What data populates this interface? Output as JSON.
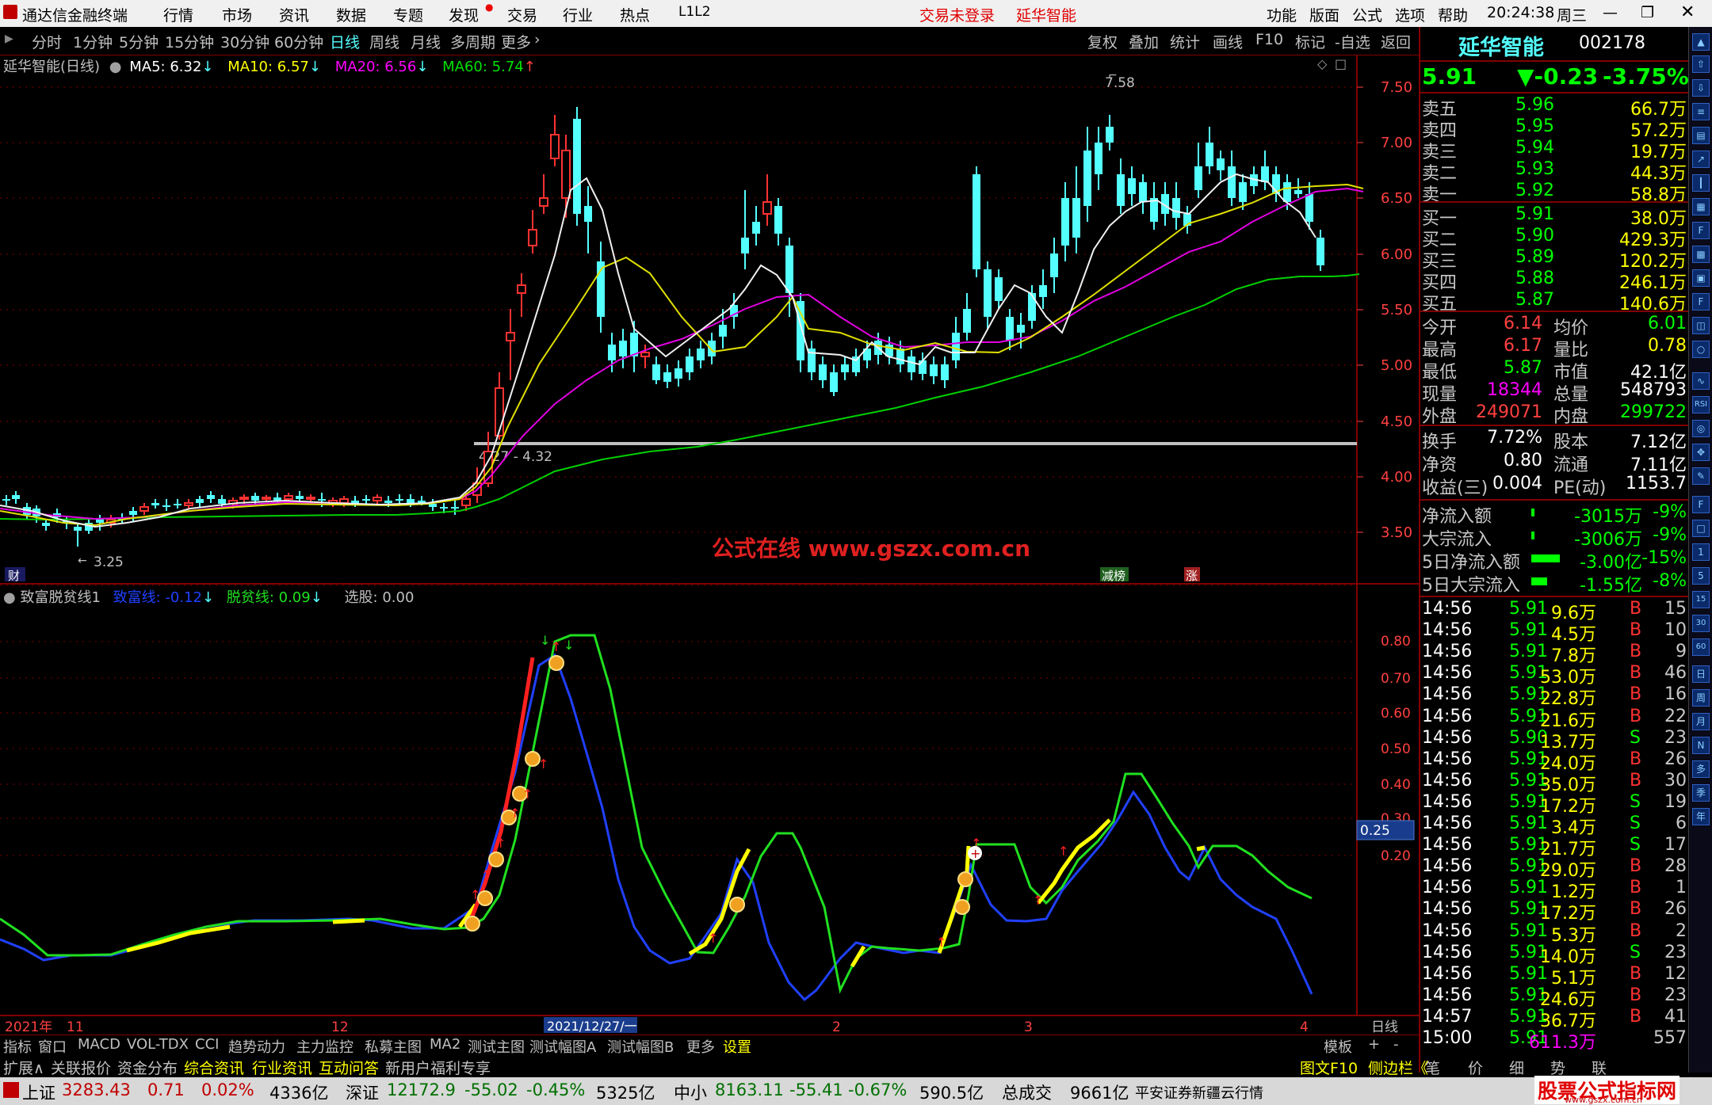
{
  "titlebar": {
    "app_name": "通达信金融终端",
    "menus": [
      "行情",
      "市场",
      "资讯",
      "数据",
      "专题",
      "发现",
      "交易",
      "行业",
      "热点",
      "L1L2"
    ],
    "login_status": "交易未登录",
    "stock_title": "延华智能",
    "right_menus": [
      "功能",
      "版面",
      "公式",
      "选项",
      "帮助"
    ],
    "time": "20:24:38",
    "weekday": "周三"
  },
  "periodbar": {
    "periods": [
      "分时",
      "1分钟",
      "5分钟",
      "15分钟",
      "30分钟",
      "60分钟",
      "日线",
      "周线",
      "月线",
      "多周期",
      "更多"
    ],
    "active": "日线",
    "tools": [
      "复权",
      "叠加",
      "统计",
      "画线",
      "F10",
      "标记",
      "-自选",
      "返回"
    ]
  },
  "main_chart": {
    "title": "延华智能(日线)",
    "ma_labels": [
      {
        "text": "MA5: 6.32",
        "arrow": "↓",
        "color": "#ffffff"
      },
      {
        "text": "MA10: 6.57",
        "arrow": "↓",
        "color": "#ffff00"
      },
      {
        "text": "MA20: 6.56",
        "arrow": "↓",
        "color": "#ff00ff"
      },
      {
        "text": "MA60: 5.74",
        "arrow": "↑",
        "color": "#00e000"
      }
    ],
    "y_ticks": [
      "7.50",
      "7.00",
      "6.50",
      "6.00",
      "5.50",
      "5.00",
      "4.50",
      "4.00",
      "3.50"
    ],
    "high_label": "7.58",
    "low_label": "3.25",
    "line_label": "4/27 - 4.32",
    "watermark": "公式在线   www.gszx.com.cn",
    "marker_cai": "财",
    "marker_rank": "减榜",
    "marker_zhang": "涨"
  },
  "indicator": {
    "name": "致富脱贫线1",
    "line1_label": "致富线: -0.12",
    "line1_arrow": "↓",
    "line2_label": "脱贫线: 0.09",
    "line2_arrow": "↓",
    "select_label": "选股: 0.00",
    "y_ticks": [
      "0.80",
      "0.70",
      "0.60",
      "0.50",
      "0.40",
      "0.30",
      "0.20"
    ],
    "current_value": "0.25"
  },
  "x_axis": {
    "labels": [
      "2021年",
      "11",
      "12",
      "2021/12/27/一",
      "2",
      "3",
      "4"
    ],
    "period_label": "日线"
  },
  "bottom_tabs": [
    "指标",
    "窗口",
    "MACD",
    "VOL-TDX",
    "CCI",
    "趋势动力",
    "主力监控",
    "私募主图",
    "MA2",
    "测试主图",
    "测试幅图A",
    "测试幅图B",
    "更多",
    "设置"
  ],
  "bottom_tabs_right": [
    "模板",
    "+",
    "-"
  ],
  "bottom_tabs2": [
    "扩展∧",
    "关联报价",
    "资金分布",
    "综合资讯",
    "行业资讯",
    "互动问答",
    "新用户福利专享"
  ],
  "bottom_tabs2_right": [
    "图文F10",
    "侧边栏《",
    "笔",
    "价",
    "细",
    "势",
    "联"
  ],
  "quote": {
    "name": "延华智能",
    "code": "002178",
    "price": "5.91",
    "change": "▼-0.23",
    "change_pct": "-3.75%",
    "asks": [
      {
        "label": "卖五",
        "price": "5.96",
        "vol": "66.7万"
      },
      {
        "label": "卖四",
        "price": "5.95",
        "vol": "57.2万"
      },
      {
        "label": "卖三",
        "price": "5.94",
        "vol": "19.7万"
      },
      {
        "label": "卖二",
        "price": "5.93",
        "vol": "44.3万"
      },
      {
        "label": "卖一",
        "price": "5.92",
        "vol": "58.8万"
      }
    ],
    "bids": [
      {
        "label": "买一",
        "price": "5.91",
        "vol": "38.0万"
      },
      {
        "label": "买二",
        "price": "5.90",
        "vol": "429.3万"
      },
      {
        "label": "买三",
        "price": "5.89",
        "vol": "120.2万"
      },
      {
        "label": "买四",
        "price": "5.88",
        "vol": "246.1万"
      },
      {
        "label": "买五",
        "price": "5.87",
        "vol": "140.6万"
      }
    ],
    "stats": [
      {
        "l1": "今开",
        "v1": "6.14",
        "l2": "均价",
        "v2": "6.01"
      },
      {
        "l1": "最高",
        "v1": "6.17",
        "l2": "量比",
        "v2": "0.78"
      },
      {
        "l1": "最低",
        "v1": "5.87",
        "l2": "市值",
        "v2": "42.1亿"
      },
      {
        "l1": "现量",
        "v1": "18344",
        "l2": "总量",
        "v2": "548793"
      },
      {
        "l1": "外盘",
        "v1": "249071",
        "l2": "内盘",
        "v2": "299722"
      }
    ],
    "stats2": [
      {
        "l1": "换手",
        "v1": "7.72%",
        "l2": "股本",
        "v2": "7.12亿"
      },
      {
        "l1": "净资",
        "v1": "0.80",
        "l2": "流通",
        "v2": "7.11亿"
      },
      {
        "l1": "收益(三)",
        "v1": "0.004",
        "l2": "PE(动)",
        "v2": "1153.7"
      }
    ],
    "flows": [
      {
        "label": "净流入额",
        "value": "-3015万",
        "pct": "-9%"
      },
      {
        "label": "大宗流入",
        "value": "-3006万",
        "pct": "-9%"
      },
      {
        "label": "5日净流入额",
        "value": "-3.00亿",
        "pct": "-15%"
      },
      {
        "label": "5日大宗流入",
        "value": "-1.55亿",
        "pct": "-8%"
      }
    ],
    "ticks": [
      [
        "14:56",
        "5.91",
        "9.6万",
        "B",
        "15"
      ],
      [
        "14:56",
        "5.91",
        "4.5万",
        "B",
        "10"
      ],
      [
        "14:56",
        "5.91",
        "7.8万",
        "B",
        "9"
      ],
      [
        "14:56",
        "5.91",
        "53.0万",
        "B",
        "46"
      ],
      [
        "14:56",
        "5.91",
        "22.8万",
        "B",
        "16"
      ],
      [
        "14:56",
        "5.91",
        "21.6万",
        "B",
        "22"
      ],
      [
        "14:56",
        "5.90",
        "13.7万",
        "S",
        "23"
      ],
      [
        "14:56",
        "5.91",
        "24.0万",
        "B",
        "26"
      ],
      [
        "14:56",
        "5.91",
        "35.0万",
        "B",
        "30"
      ],
      [
        "14:56",
        "5.91",
        "17.2万",
        "S",
        "19"
      ],
      [
        "14:56",
        "5.91",
        "3.4万",
        "S",
        "6"
      ],
      [
        "14:56",
        "5.91",
        "21.7万",
        "S",
        "17"
      ],
      [
        "14:56",
        "5.91",
        "29.0万",
        "B",
        "28"
      ],
      [
        "14:56",
        "5.91",
        "1.2万",
        "B",
        "1"
      ],
      [
        "14:56",
        "5.91",
        "17.2万",
        "B",
        "26"
      ],
      [
        "14:56",
        "5.91",
        "5.3万",
        "B",
        "2"
      ],
      [
        "14:56",
        "5.91",
        "14.0万",
        "S",
        "23"
      ],
      [
        "14:56",
        "5.91",
        "5.1万",
        "B",
        "12"
      ],
      [
        "14:56",
        "5.91",
        "24.6万",
        "B",
        "23"
      ],
      [
        "14:57",
        "5.91",
        "36.7万",
        "B",
        "41"
      ],
      [
        "15:00",
        "5.91",
        "611.3万",
        "",
        "557"
      ]
    ]
  },
  "iconbar_labels": [
    "日",
    "周",
    "月",
    "N",
    "多",
    "季",
    "年"
  ],
  "statusbar": {
    "items": [
      {
        "name": "上证",
        "v": "3283.43",
        "c": "0.71",
        "p": "0.02%",
        "a": "4336亿"
      },
      {
        "name": "深证",
        "v": "12172.9",
        "c": "-55.02",
        "p": "-0.45%",
        "a": "5325亿"
      },
      {
        "name": "中小",
        "v": "8163.11",
        "c": "-55.41",
        "p": "-0.67%",
        "a": "590.5亿"
      }
    ],
    "total_label": "总成交",
    "total_value": "9661亿",
    "broker": "平安证券新疆云行情",
    "logo": "股票公式指标网",
    "logo_url": "www.gszx.com.cn"
  },
  "colors": {
    "up": "#ff3232",
    "down": "#54ffff",
    "grid": "#800000",
    "accent": "#ffff00"
  }
}
